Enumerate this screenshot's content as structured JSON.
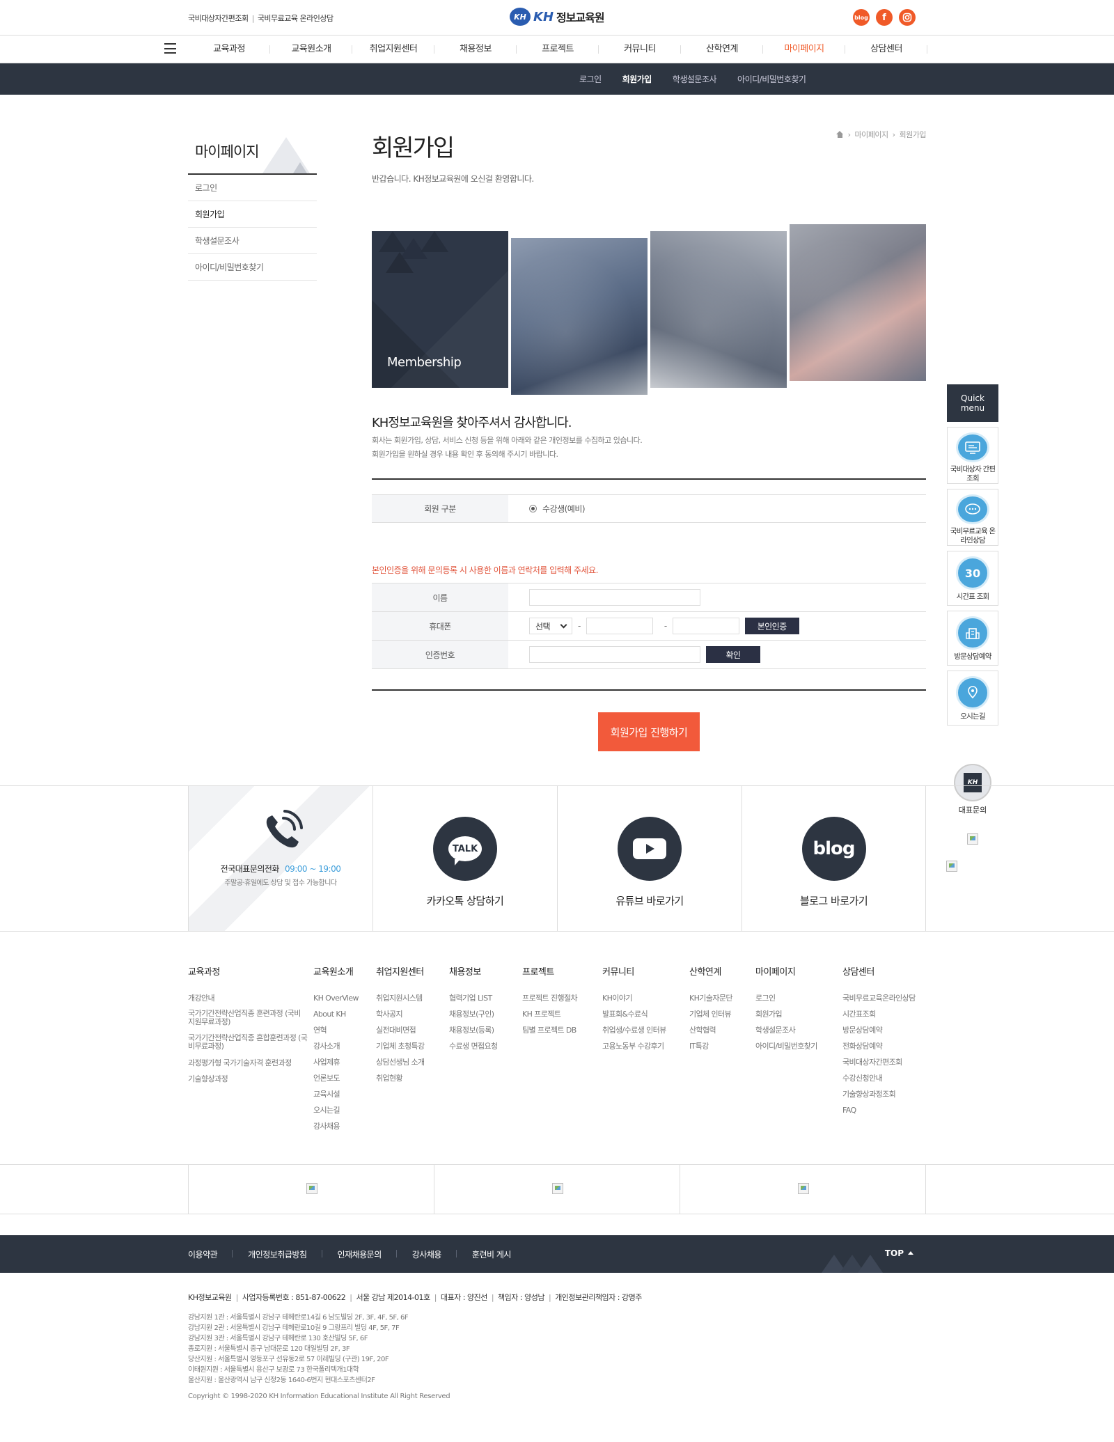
{
  "top": {
    "links": [
      "국비대상자간편조회",
      "국비무료교육 온라인상담"
    ],
    "logo_mark": "KH",
    "logo_kh": "KH",
    "logo_name": "정보교육원",
    "social": [
      "blog",
      "f",
      "ig"
    ]
  },
  "gnb": [
    "교육과정",
    "교육원소개",
    "취업지원센터",
    "채용정보",
    "프로젝트",
    "커뮤니티",
    "산학연계",
    "마이페이지",
    "상담센터"
  ],
  "subnav": [
    "로그인",
    "회원가입",
    "학생설문조사",
    "아이디/비밀번호찾기"
  ],
  "lnb": {
    "title": "마이페이지",
    "items": [
      "로그인",
      "회원가입",
      "학생설문조사",
      "아이디/비밀번호찾기"
    ]
  },
  "content": {
    "title": "회원가입",
    "greeting": "반갑습니다. KH정보교육원에 오신걸 환영합니다.",
    "breadcrumb": [
      "마이페이지",
      "회원가입"
    ],
    "visual_label": "Membership",
    "thanks_title": "KH정보교육원을 찾아주셔서 감사합니다.",
    "thanks_lines": [
      "회사는 회원가입, 상담, 서비스 신청 등을 위해 아래와 같은 개인정보를 수집하고 있습니다.",
      "회원가입을 원하실 경우 내용 확인 후 동의해 주시기 바랍니다."
    ],
    "member_type_label": "회원 구분",
    "member_type_value": "수강생(예비)",
    "notice": "본인인증을 위해 문의등록 시 사용한 이름과 연락처를 입력해 주세요.",
    "name_label": "이름",
    "phone_label": "휴대폰",
    "phone_select": "선택",
    "phone_dash": "-",
    "verify_button": "본인인증",
    "code_label": "인증번호",
    "confirm_button": "확인",
    "submit": "회원가입 진행하기"
  },
  "quick": {
    "head": [
      "Quick",
      "menu"
    ],
    "items": [
      {
        "icon": "monitor-icon",
        "label": "국비대상자 간편조회"
      },
      {
        "icon": "chat-icon",
        "label": "국비무료교육 온라인상담"
      },
      {
        "icon": "calendar-icon",
        "glyph": "30",
        "label": "시간표 조회"
      },
      {
        "icon": "building-icon",
        "label": "방문상담예약"
      },
      {
        "icon": "map-icon",
        "label": "오시는길"
      }
    ],
    "rep_mark": "KH",
    "rep_label": "대표문의"
  },
  "contact": {
    "tel_title": "전국대표문의전화",
    "tel_hours": "09:00 ~ 19:00",
    "tel_sub": "주말공·휴일에도 상담 및 접수 가능합니다",
    "talk_glyph": "TALK",
    "talk_label": "카카오톡 상담하기",
    "youtube_label": "유튜브 바로가기",
    "blog_glyph": "blog",
    "blog_label": "블로그 바로가기"
  },
  "sitemap": [
    {
      "title": "교육과정",
      "items": [
        "개강안내",
        "국가기간전략산업직종 훈련과정 (국비지원무료과정)",
        "국가기간전략산업직종 혼합훈련과정 (국비무료과정)",
        "과정평가형 국가기술자격 훈련과정",
        "기술향상과정"
      ]
    },
    {
      "title": "교육원소개",
      "items": [
        "KH OverView",
        "About KH",
        "연혁",
        "강사소개",
        "사업제휴",
        "언론보도",
        "교육시설",
        "오시는길",
        "강사채용"
      ]
    },
    {
      "title": "취업지원센터",
      "items": [
        "취업지원시스템",
        "학사공지",
        "실전대비면접",
        "기업체 초청특강",
        "상담선생님 소개",
        "취업현황"
      ]
    },
    {
      "title": "채용정보",
      "items": [
        "협력기업 LIST",
        "채용정보(구인)",
        "채용정보(등록)",
        "수료생 면접요청"
      ]
    },
    {
      "title": "프로젝트",
      "items": [
        "프로젝트 진행절차",
        "KH 프로젝트",
        "팀별 프로젝트 DB"
      ]
    },
    {
      "title": "커뮤니티",
      "items": [
        "KH이야기",
        "발표회&수료식",
        "취업생/수료생 인터뷰",
        "고용노동부 수강후기"
      ]
    },
    {
      "title": "산학연계",
      "items": [
        "KH기술자문단",
        "기업체 인터뷰",
        "산학협력",
        "IT특강"
      ]
    },
    {
      "title": "마이페이지",
      "items": [
        "로그인",
        "회원가입",
        "학생설문조사",
        "아이디/비밀번호찾기"
      ]
    },
    {
      "title": "상담센터",
      "items": [
        "국비무료교육온라인상담",
        "시간표조회",
        "방문상담예약",
        "전화상담예약",
        "국비대상자간편조회",
        "수강신청안내",
        "기술향상과정조회",
        "FAQ"
      ]
    }
  ],
  "footer": {
    "nav": [
      "이용약관",
      "개인정보취급방침",
      "인재채용문의",
      "강사채용",
      "훈련비 게시"
    ],
    "top": "TOP",
    "company": [
      "KH정보교육원",
      "사업자등록번호 : 851-87-00622",
      "서울 강남 제2014-01호",
      "대표자 : 양진선",
      "책임자 : 양성남",
      "개인정보관리책임자 : 강명주"
    ],
    "addresses": [
      "강남지원 1관 : 서울특별시 강남구 테헤란로14길 6 남도빌딩 2F, 3F, 4F, 5F, 6F",
      "강남지원 2관 : 서울특별시 강남구 테헤란로10길 9 그랑프리 빌딩 4F, 5F, 7F",
      "강남지원 3관 : 서울특별시 강남구 테헤란로 130 호산빌딩 5F, 6F",
      "종로지원 : 서울특별시 중구 남대문로 120 대일빌딩 2F, 3F",
      "당산지원 : 서울특별시 영등포구 선유동2로 57 이레빌딩 (구관) 19F, 20F",
      "이태원지원 : 서울특별시 용산구 보광로 73 한국폴리텍개1대학",
      "울산지원 : 울산광역시 남구 신정2동 1640-6번지 현대스포츠센터2F"
    ],
    "copyright": "Copyright © 1998-2020 KH Information Educational Institute All Right Reserved"
  },
  "colors": {
    "accent": "#f05a28",
    "dark": "#2d3541",
    "submit": "#f25a3b",
    "blue": "#3f9fdb"
  }
}
